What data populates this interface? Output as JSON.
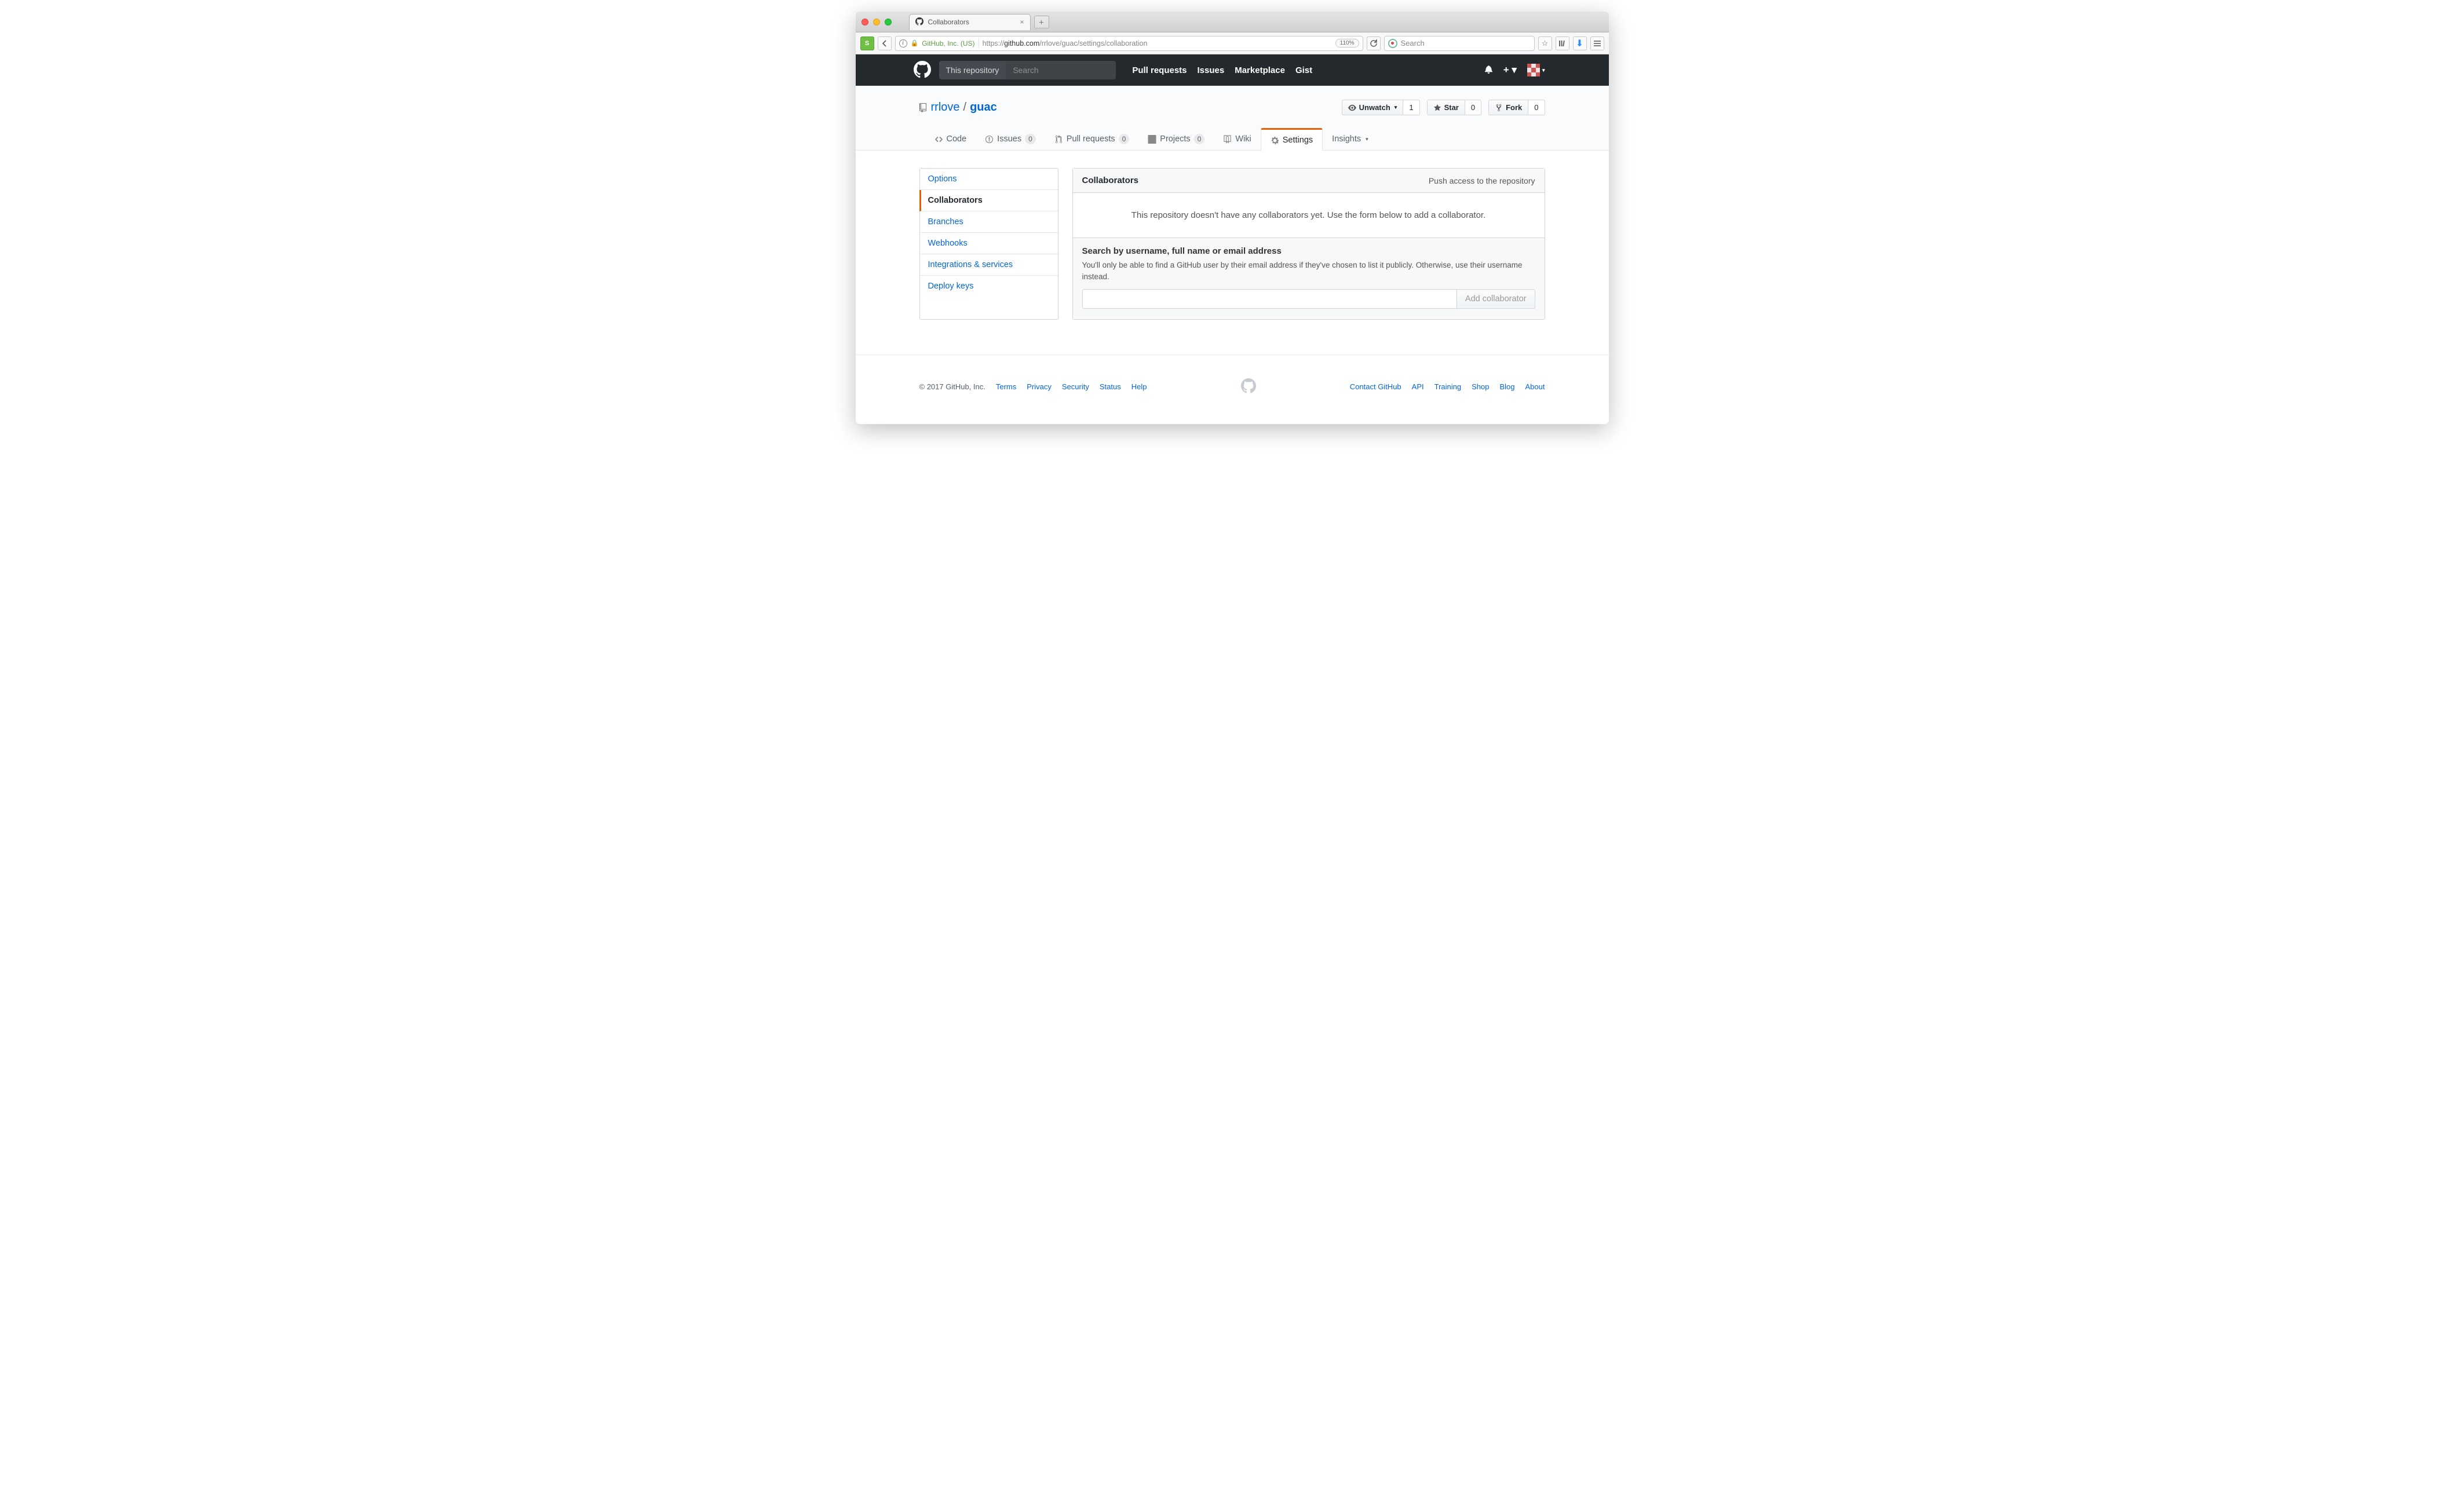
{
  "browser": {
    "tab_title": "Collaborators",
    "url_identity": "GitHub, Inc. (US)",
    "url_prefix": "https://",
    "url_host": "github.com",
    "url_path": "/rrlove/guac/settings/collaboration",
    "zoom": "110%",
    "search_placeholder": "Search"
  },
  "header": {
    "scope_label": "This repository",
    "search_placeholder": "Search",
    "nav": {
      "pull_requests": "Pull requests",
      "issues": "Issues",
      "marketplace": "Marketplace",
      "gist": "Gist"
    }
  },
  "repo": {
    "owner": "rrlove",
    "separator": "/",
    "name": "guac",
    "actions": {
      "unwatch": "Unwatch",
      "unwatch_count": "1",
      "star": "Star",
      "star_count": "0",
      "fork": "Fork",
      "fork_count": "0"
    },
    "tabs": {
      "code": "Code",
      "issues": "Issues",
      "issues_count": "0",
      "prs": "Pull requests",
      "prs_count": "0",
      "projects": "Projects",
      "projects_count": "0",
      "wiki": "Wiki",
      "settings": "Settings",
      "insights": "Insights"
    }
  },
  "sidebar": {
    "options": "Options",
    "collaborators": "Collaborators",
    "branches": "Branches",
    "webhooks": "Webhooks",
    "integrations": "Integrations & services",
    "deploy_keys": "Deploy keys"
  },
  "panel": {
    "title": "Collaborators",
    "subtitle": "Push access to the repository",
    "empty": "This repository doesn't have any collaborators yet. Use the form below to add a collaborator.",
    "search_title": "Search by username, full name or email address",
    "search_help": "You'll only be able to find a GitHub user by their email address if they've chosen to list it publicly. Otherwise, use their username instead.",
    "add_button": "Add collaborator"
  },
  "footer": {
    "copyright": "© 2017 GitHub, Inc.",
    "left": [
      "Terms",
      "Privacy",
      "Security",
      "Status",
      "Help"
    ],
    "right": [
      "Contact GitHub",
      "API",
      "Training",
      "Shop",
      "Blog",
      "About"
    ]
  }
}
